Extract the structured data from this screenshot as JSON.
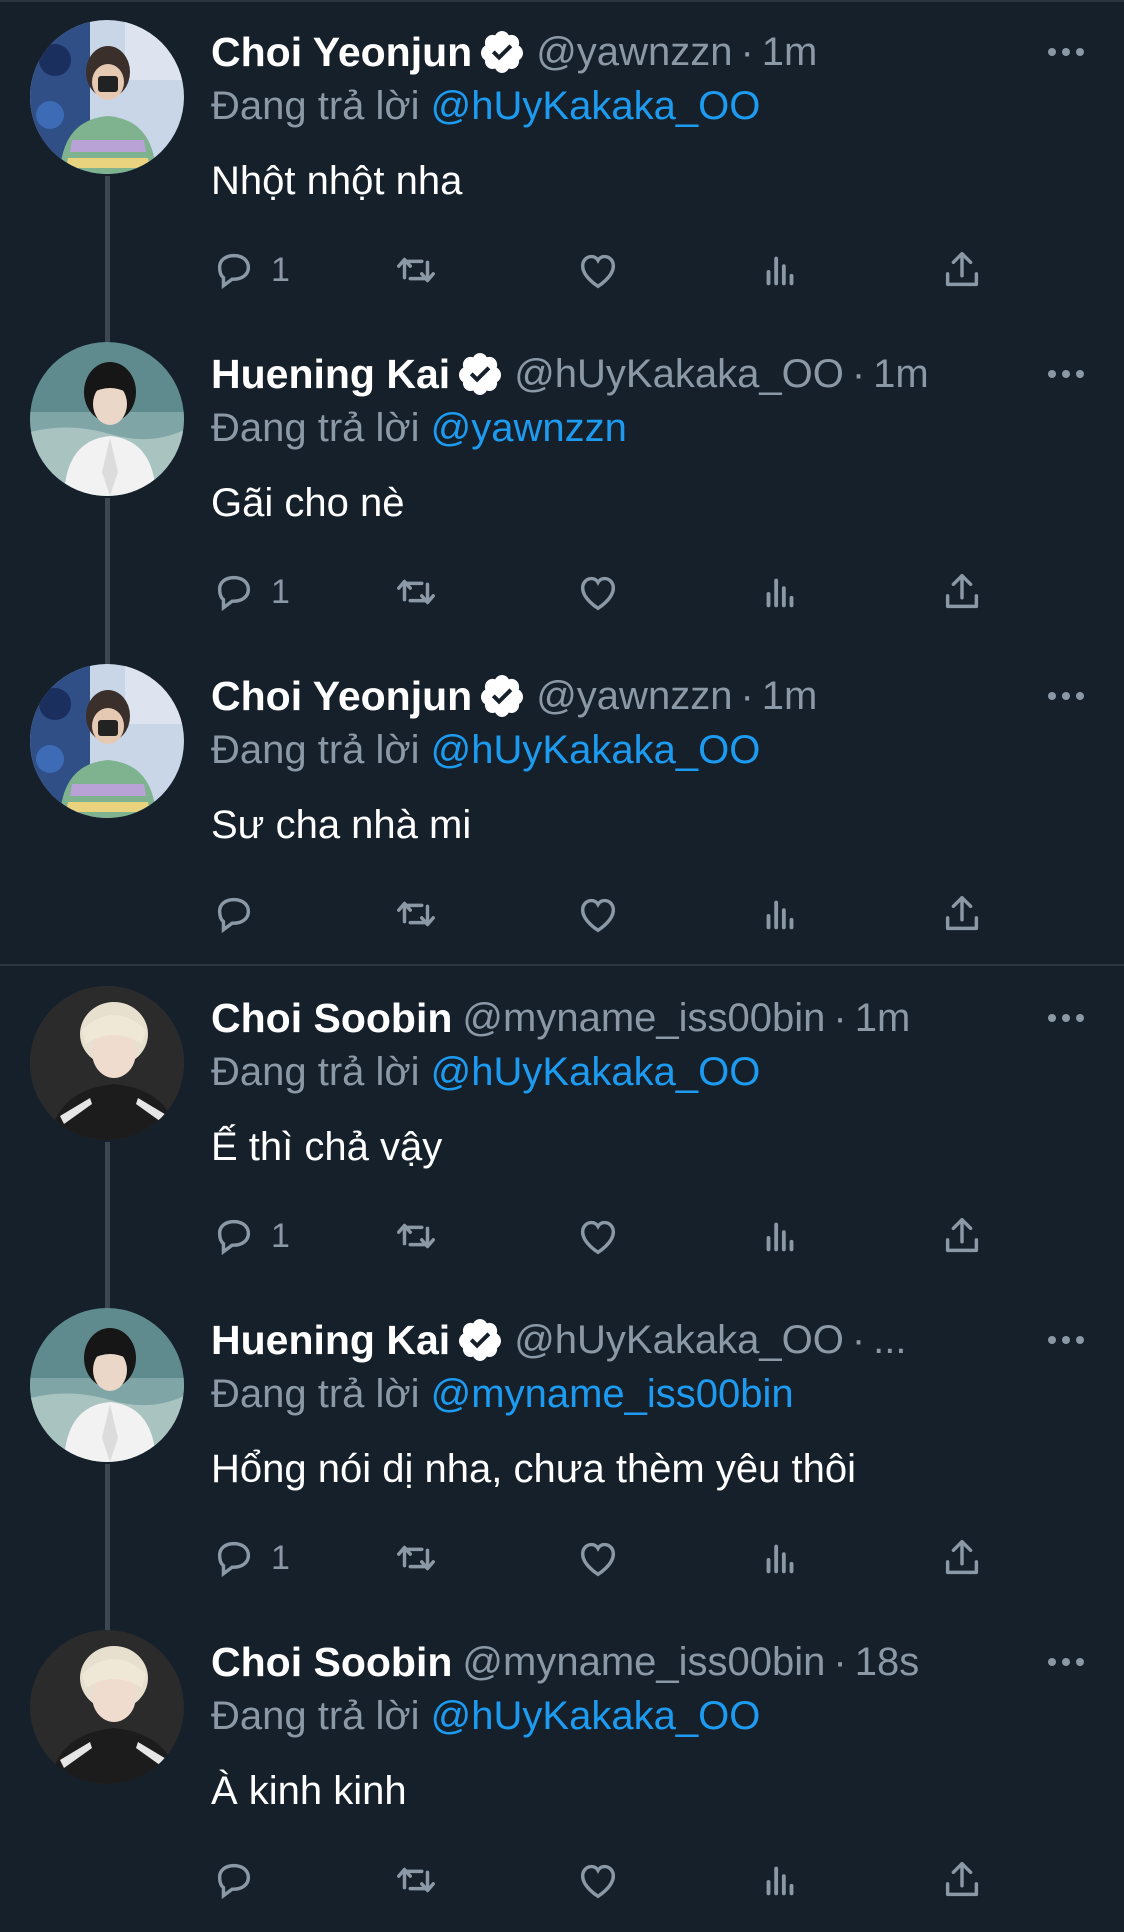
{
  "colors": {
    "background": "#15202b",
    "text_primary": "#ffffff",
    "text_secondary": "#8b98a5",
    "mention": "#1d9bf0",
    "verified_badge": "#ffffff"
  },
  "reply_prefix": "Đang trả lời",
  "threads": [
    {
      "tweets": [
        {
          "author": "Choi Yeonjun",
          "verified": true,
          "handle": "@yawnzzn",
          "separator": "·",
          "time": "1m",
          "reply_to": "@hUyKakaka_OO",
          "text": "Nhột nhột nha",
          "reply_count": "1"
        },
        {
          "author": "Huening Kai",
          "verified": true,
          "handle": "@hUyKakaka_OO",
          "separator": "·",
          "time": "1m",
          "reply_to": "@yawnzzn",
          "text": "Gãi cho nè",
          "reply_count": "1"
        },
        {
          "author": "Choi Yeonjun",
          "verified": true,
          "handle": "@yawnzzn",
          "separator": "·",
          "time": "1m",
          "reply_to": "@hUyKakaka_OO",
          "text": "Sư cha nhà mi",
          "reply_count": ""
        }
      ]
    },
    {
      "tweets": [
        {
          "author": "Choi Soobin",
          "verified": false,
          "handle": "@myname_iss00bin",
          "separator": "·",
          "time": "1m",
          "reply_to": "@hUyKakaka_OO",
          "text": "Ế thì chả vậy",
          "reply_count": "1"
        },
        {
          "author": "Huening Kai",
          "verified": true,
          "handle": "@hUyKakaka_OO",
          "separator": "·",
          "time": "...",
          "reply_to": "@myname_iss00bin",
          "text": "Hổng nói dị nha, chưa thèm yêu thôi",
          "reply_count": "1"
        },
        {
          "author": "Choi Soobin",
          "verified": false,
          "handle": "@myname_iss00bin",
          "separator": "·",
          "time": "18s",
          "reply_to": "@hUyKakaka_OO",
          "text": "À kinh kinh",
          "reply_count": ""
        }
      ]
    }
  ],
  "icons": {
    "reply": "speech-bubble-icon",
    "retweet": "retweet-icon",
    "like": "heart-icon",
    "views": "analytics-icon",
    "share": "share-icon",
    "more": "more-dots-icon",
    "verified": "verified-check-icon"
  }
}
